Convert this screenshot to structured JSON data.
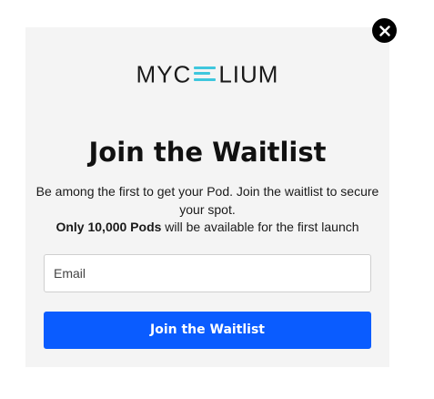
{
  "modal": {
    "logo": {
      "before": "MYC",
      "after": "LIUM",
      "accent_color": "#3fc7dd"
    },
    "title": "Join the Waitlist",
    "description_line1": "Be among the first to get your Pod. Join the waitlist to secure your spot.",
    "description_bold": "Only 10,000 Pods",
    "description_rest": " will be available for the first launch",
    "email_placeholder": "Email",
    "submit_label": "Join the Waitlist",
    "button_color": "#0a5cff",
    "close_icon": "close-icon"
  }
}
